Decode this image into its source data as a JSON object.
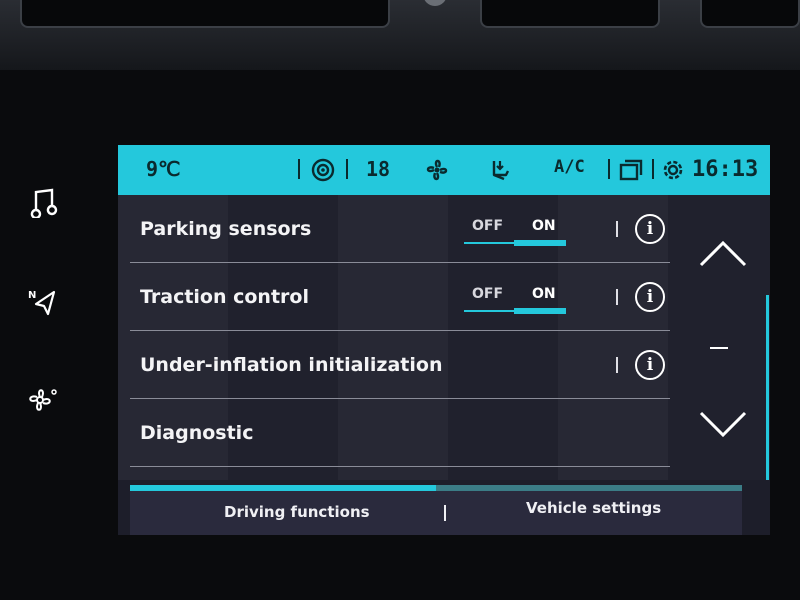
{
  "status_bar": {
    "temperature": "9℃",
    "fan_speed": "18",
    "ac_label": "A/C",
    "time": "16:13"
  },
  "settings": [
    {
      "label": "Parking sensors",
      "has_toggle": true,
      "toggle_off": "OFF",
      "toggle_on": "ON",
      "state": "ON",
      "has_info": true
    },
    {
      "label": "Traction control",
      "has_toggle": true,
      "toggle_off": "OFF",
      "toggle_on": "ON",
      "state": "ON",
      "has_info": true
    },
    {
      "label": "Under-inflation initialization",
      "has_toggle": false,
      "has_info": true
    },
    {
      "label": "Diagnostic",
      "has_toggle": false,
      "has_info": false
    }
  ],
  "info_glyph": "i",
  "tabs": [
    {
      "label": "Driving functions"
    },
    {
      "label": "Vehicle settings"
    }
  ],
  "active_tab_fraction": 0.5,
  "icons": [
    "music-note-icon",
    "navigation-icon",
    "fan-icon",
    "radar-icon",
    "climate-fan-icon",
    "seat-airflow-icon",
    "screen-mirror-icon",
    "gear-icon",
    "scroll-up-icon",
    "scroll-down-icon"
  ],
  "colors": {
    "accent": "#24c8dc",
    "panel": "#22232f",
    "text": "#ffffff"
  }
}
